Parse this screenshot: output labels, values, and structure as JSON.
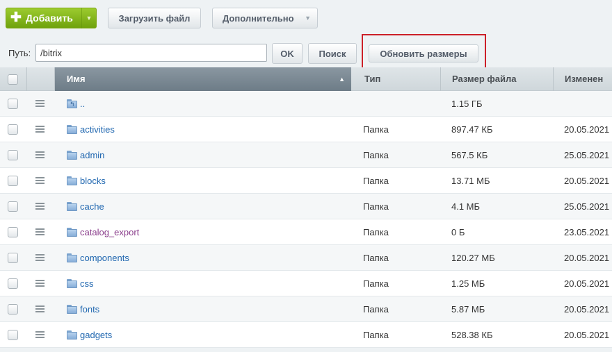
{
  "toolbar": {
    "add_label": "Добавить",
    "upload_label": "Загрузить файл",
    "more_label": "Дополнительно"
  },
  "pathbar": {
    "label": "Путь:",
    "value": "/bitrix",
    "ok_label": "OK",
    "search_label": "Поиск",
    "refresh_label": "Обновить размеры"
  },
  "columns": {
    "name": "Имя",
    "type": "Тип",
    "size": "Размер файла",
    "modified": "Изменен"
  },
  "rows": [
    {
      "name": "..",
      "type": "",
      "size": "1.15 ГБ",
      "date": ""
    },
    {
      "name": "activities",
      "type": "Папка",
      "size": "897.47 КБ",
      "date": "20.05.2021"
    },
    {
      "name": "admin",
      "type": "Папка",
      "size": "567.5 КБ",
      "date": "25.05.2021"
    },
    {
      "name": "blocks",
      "type": "Папка",
      "size": "13.71 МБ",
      "date": "20.05.2021"
    },
    {
      "name": "cache",
      "type": "Папка",
      "size": "4.1 МБ",
      "date": "25.05.2021"
    },
    {
      "name": "catalog_export",
      "type": "Папка",
      "size": "0 Б",
      "date": "23.05.2021"
    },
    {
      "name": "components",
      "type": "Папка",
      "size": "120.27 МБ",
      "date": "20.05.2021"
    },
    {
      "name": "css",
      "type": "Папка",
      "size": "1.25 МБ",
      "date": "20.05.2021"
    },
    {
      "name": "fonts",
      "type": "Папка",
      "size": "5.87 МБ",
      "date": "20.05.2021"
    },
    {
      "name": "gadgets",
      "type": "Папка",
      "size": "528.38 КБ",
      "date": "20.05.2021"
    }
  ]
}
